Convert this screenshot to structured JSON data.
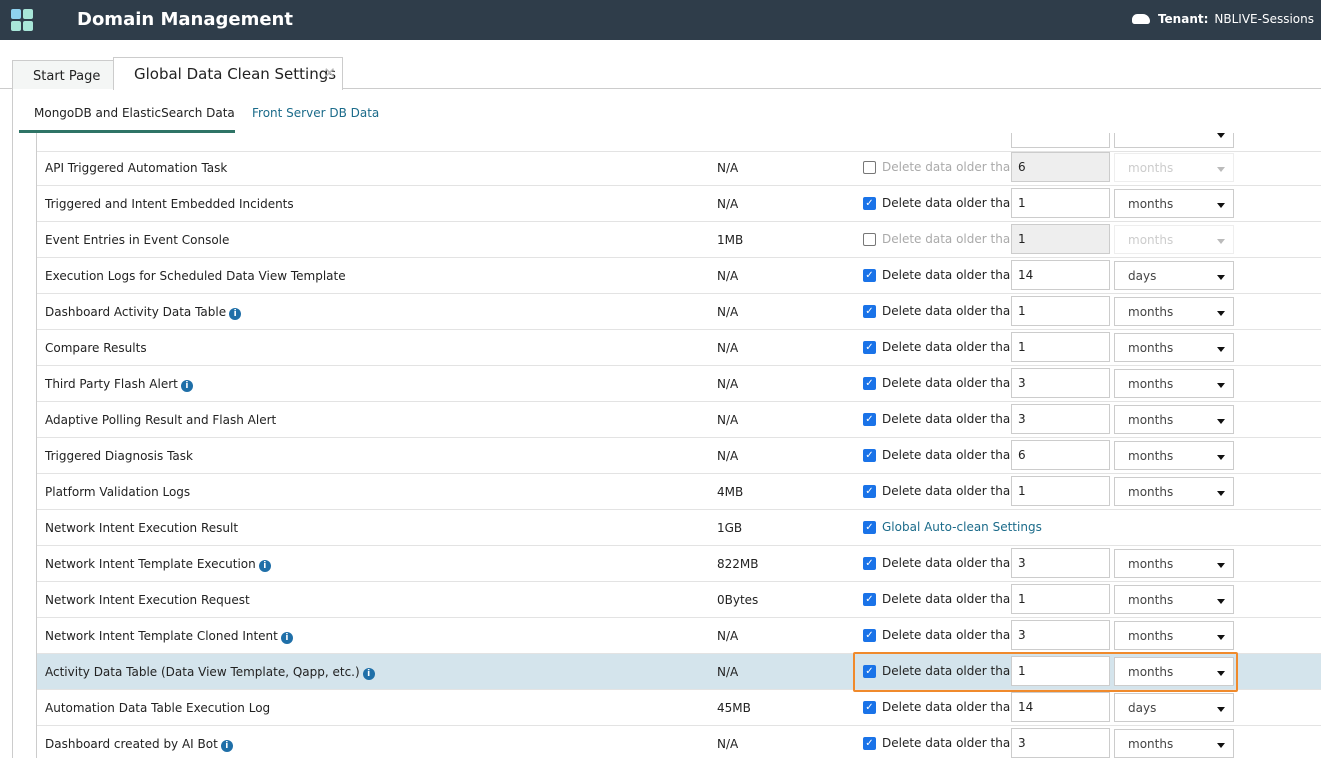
{
  "header": {
    "title": "Domain Management",
    "tenant_label": "Tenant:",
    "tenant_value": "NBLIVE-Sessions"
  },
  "tabs": [
    {
      "label": "Start Page"
    },
    {
      "label": "Global Data Clean Settings"
    }
  ],
  "subtabs": [
    {
      "label": "MongoDB and ElasticSearch Data"
    },
    {
      "label": "Front Server DB Data"
    }
  ],
  "rows": [
    {
      "name": "API Triggered Automation Task",
      "info": false,
      "size": "N/A",
      "checked": false,
      "label": "Delete data older than",
      "value": "6",
      "unit": "months"
    },
    {
      "name": "Triggered and Intent Embedded Incidents",
      "info": false,
      "size": "N/A",
      "checked": true,
      "label": "Delete data older than",
      "value": "1",
      "unit": "months"
    },
    {
      "name": "Event Entries in Event Console",
      "info": false,
      "size": "1MB",
      "checked": false,
      "label": "Delete data older than",
      "value": "1",
      "unit": "months"
    },
    {
      "name": "Execution Logs for Scheduled Data View Template",
      "info": false,
      "size": "N/A",
      "checked": true,
      "label": "Delete data older than",
      "value": "14",
      "unit": "days"
    },
    {
      "name": "Dashboard Activity Data Table",
      "info": true,
      "size": "N/A",
      "checked": true,
      "label": "Delete data older than",
      "value": "1",
      "unit": "months"
    },
    {
      "name": "Compare Results",
      "info": false,
      "size": "N/A",
      "checked": true,
      "label": "Delete data older than",
      "value": "1",
      "unit": "months"
    },
    {
      "name": "Third Party Flash Alert",
      "info": true,
      "size": "N/A",
      "checked": true,
      "label": "Delete data older than",
      "value": "3",
      "unit": "months"
    },
    {
      "name": "Adaptive Polling Result and Flash Alert",
      "info": false,
      "size": "N/A",
      "checked": true,
      "label": "Delete data older than",
      "value": "3",
      "unit": "months"
    },
    {
      "name": "Triggered Diagnosis Task",
      "info": false,
      "size": "N/A",
      "checked": true,
      "label": "Delete data older than",
      "value": "6",
      "unit": "months"
    },
    {
      "name": "Platform Validation Logs",
      "info": false,
      "size": "4MB",
      "checked": true,
      "label": "Delete data older than",
      "value": "1",
      "unit": "months"
    },
    {
      "name": "Network Intent Execution Result",
      "info": false,
      "size": "1GB",
      "checked": true,
      "label": "Global Auto-clean Settings",
      "global": true
    },
    {
      "name": "Network Intent Template Execution",
      "info": true,
      "size": "822MB",
      "checked": true,
      "label": "Delete data older than",
      "value": "3",
      "unit": "months"
    },
    {
      "name": "Network Intent Execution Request",
      "info": false,
      "size": "0Bytes",
      "checked": true,
      "label": "Delete data older than",
      "value": "1",
      "unit": "months"
    },
    {
      "name": "Network Intent Template Cloned Intent",
      "info": true,
      "size": "N/A",
      "checked": true,
      "label": "Delete data older than",
      "value": "3",
      "unit": "months"
    },
    {
      "name": "Activity Data Table (Data View Template, Qapp, etc.)",
      "info": true,
      "size": "N/A",
      "checked": true,
      "label": "Delete data older than",
      "value": "1",
      "unit": "months",
      "highlighted": true
    },
    {
      "name": "Automation Data Table Execution Log",
      "info": false,
      "size": "45MB",
      "checked": true,
      "label": "Delete data older than",
      "value": "14",
      "unit": "days"
    },
    {
      "name": "Dashboard created by AI Bot",
      "info": true,
      "size": "N/A",
      "checked": true,
      "label": "Delete data older than",
      "value": "3",
      "unit": "months"
    }
  ],
  "colors": {
    "topbar": "#2f3d4a",
    "accent": "#2e7466",
    "highlight": "#f08a2c",
    "checkbox": "#1a73e8"
  }
}
